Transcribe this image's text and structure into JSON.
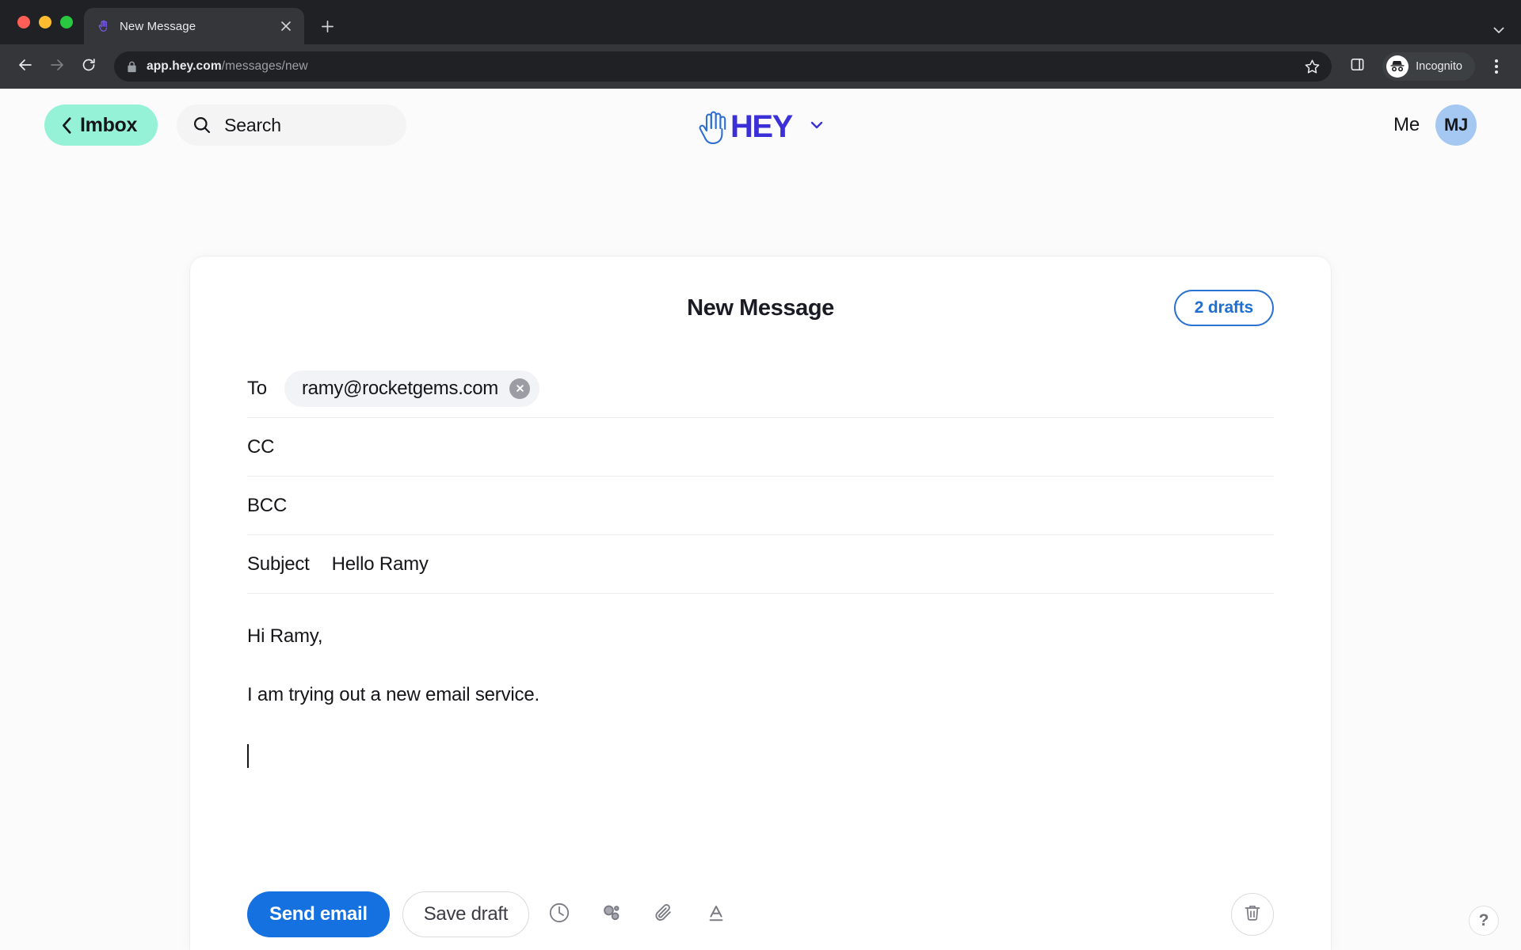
{
  "browser": {
    "tab": {
      "title": "New Message",
      "favicon_icon": "hey-hand-favicon",
      "close_icon": "close-icon"
    },
    "new_tab_icon": "plus-icon",
    "tabstrip_chevron_icon": "chevron-down-icon",
    "back_icon": "arrow-left-icon",
    "forward_icon": "arrow-right-icon",
    "reload_icon": "reload-icon",
    "omnibox": {
      "lock_icon": "lock-icon",
      "url_host": "app.hey.com",
      "url_path": "/messages/new",
      "star_icon": "star-icon",
      "side_panel_icon": "side-panel-icon"
    },
    "profile": {
      "label": "Incognito",
      "icon": "incognito-hat-icon"
    },
    "menu_icon": "kebab-menu-icon"
  },
  "app_header": {
    "imbox_button": {
      "label": "Imbox",
      "icon": "chevron-left-icon",
      "background": "#96f2d7"
    },
    "search": {
      "label": "Search",
      "placeholder": "Search",
      "icon": "search-icon"
    },
    "logo": {
      "wordmark": "HEY",
      "icon": "waving-hand-icon",
      "chevron_icon": "chevron-down-icon",
      "color": "#3b30d8"
    },
    "account": {
      "label": "Me",
      "avatar_initials": "MJ",
      "avatar_background": "#a5c8f2"
    }
  },
  "compose": {
    "title": "New Message",
    "drafts_badge": {
      "label": "2 drafts",
      "color": "#1f6fd0"
    },
    "fields": {
      "to": {
        "label": "To",
        "recipients": [
          {
            "address": "ramy@rocketgems.com",
            "remove_icon": "close-icon"
          }
        ]
      },
      "cc": {
        "label": "CC",
        "value": ""
      },
      "bcc": {
        "label": "BCC",
        "value": ""
      },
      "subject": {
        "label": "Subject",
        "value": "Hello Ramy"
      }
    },
    "body": {
      "lines": [
        "Hi Ramy,",
        "I am trying out a new email service."
      ],
      "caret_visible": true
    },
    "actions": {
      "send": {
        "label": "Send email",
        "color": "#1570e0"
      },
      "save_draft": {
        "label": "Save draft"
      },
      "tools": [
        {
          "name": "schedule-send",
          "icon": "clock-icon"
        },
        {
          "name": "tracking-pixels",
          "icon": "bubbles-icon"
        },
        {
          "name": "attach-file",
          "icon": "paperclip-icon"
        },
        {
          "name": "text-formatting",
          "icon": "text-format-icon"
        }
      ],
      "delete": {
        "icon": "trash-icon"
      }
    }
  },
  "help": {
    "label": "?",
    "icon": "question-mark-icon"
  }
}
